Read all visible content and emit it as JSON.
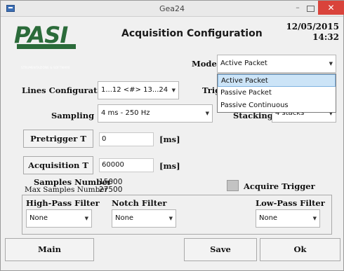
{
  "window": {
    "title": "Gea24",
    "close": "✕",
    "min": "–"
  },
  "logo": {
    "text": "PASI",
    "subtitle": "STRUMENTAZIONE & SOFTWARE"
  },
  "page_title": "Acquisition Configuration",
  "datetime": {
    "date": "12/05/2015",
    "time": "14:32"
  },
  "mode": {
    "label": "Mode",
    "value": "Active Packet",
    "options": [
      "Active Packet",
      "Passive Packet",
      "Passive Continuous"
    ],
    "selected_index": 0
  },
  "lines": {
    "label": "Lines Configuration",
    "value": "1...12 <#> 13...24"
  },
  "trigger": {
    "label": "Trigg"
  },
  "sampling": {
    "label": "Sampling",
    "value": "4 ms - 250 Hz"
  },
  "stacking": {
    "label": "Stacking",
    "value": "4 stacks"
  },
  "pretrigger": {
    "button": "Pretrigger T",
    "value": "0",
    "unit": "[ms]"
  },
  "acquisition": {
    "button": "Acquisition T",
    "value": "60000",
    "unit": "[ms]"
  },
  "samples": {
    "label": "Samples Number",
    "value": "15000",
    "max_label": "Max Samples Number",
    "max_value": "27500"
  },
  "acquire_trigger": {
    "label": "Acquire Trigger"
  },
  "filters": {
    "high_pass": {
      "label": "High-Pass Filter",
      "value": "None"
    },
    "notch": {
      "label": "Notch Filter",
      "value": "None"
    },
    "low_pass": {
      "label": "Low-Pass Filter",
      "value": "None"
    }
  },
  "buttons": {
    "main": "Main",
    "save": "Save",
    "ok": "Ok"
  },
  "colors": {
    "logo_green": "#2b6b3a",
    "close_red": "#d9433b",
    "selection_blue": "#cce4f7"
  }
}
